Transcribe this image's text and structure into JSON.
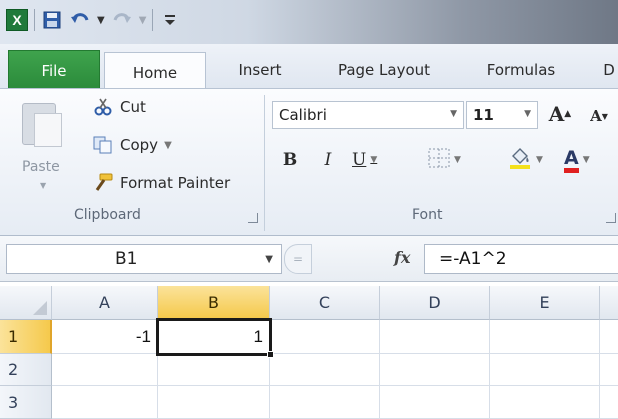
{
  "quick_access": {
    "logo_text": "X",
    "icons": [
      "excel-logo-icon",
      "save-icon",
      "undo-icon",
      "redo-icon",
      "customize-toolbar-icon"
    ]
  },
  "tabs": [
    {
      "label": "File"
    },
    {
      "label": "Home"
    },
    {
      "label": "Insert"
    },
    {
      "label": "Page Layout"
    },
    {
      "label": "Formulas"
    },
    {
      "label": "D"
    }
  ],
  "clipboard": {
    "paste_label": "Paste",
    "cut_label": "Cut",
    "copy_label": "Copy",
    "format_painter_label": "Format Painter",
    "group_label": "Clipboard"
  },
  "font": {
    "name": "Calibri",
    "size": "11",
    "bold_label": "B",
    "italic_label": "I",
    "underline_label": "U",
    "grow_label": "A",
    "shrink_label": "A",
    "font_color_label": "A",
    "group_label": "Font"
  },
  "formula_bar": {
    "name_box": "B1",
    "fx_label": "fx",
    "formula": "=-A1^2"
  },
  "grid": {
    "columns": [
      "A",
      "B",
      "C",
      "D",
      "E"
    ],
    "rows": [
      "1",
      "2",
      "3"
    ],
    "cells": {
      "A1": "-1",
      "B1": "1"
    },
    "selected_cell": "B1"
  },
  "colors": {
    "file_tab": "#2a8a3a",
    "selection_header": "#f5c94c",
    "font_color_accent": "#e02020",
    "highlight_accent": "#f4e11c"
  }
}
